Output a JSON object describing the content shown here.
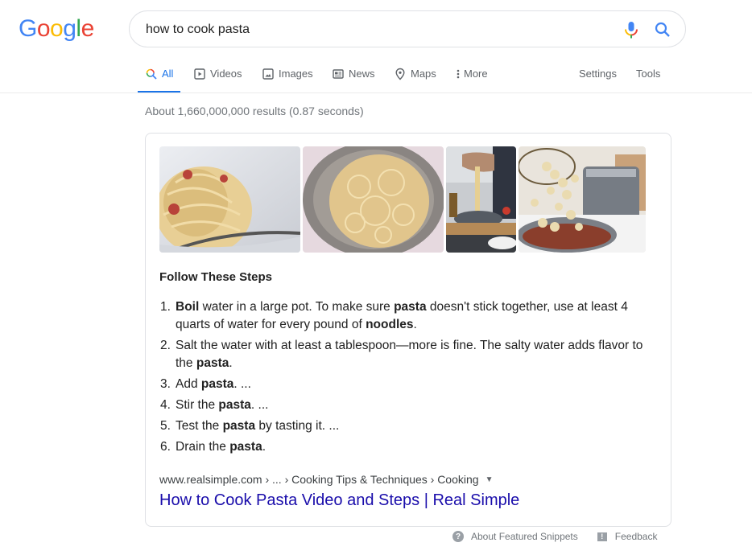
{
  "logo": {
    "letters": [
      {
        "ch": "G",
        "color": "#4285f4"
      },
      {
        "ch": "o",
        "color": "#ea4335"
      },
      {
        "ch": "o",
        "color": "#fbbc05"
      },
      {
        "ch": "g",
        "color": "#4285f4"
      },
      {
        "ch": "l",
        "color": "#34a853"
      },
      {
        "ch": "e",
        "color": "#ea4335"
      }
    ]
  },
  "search": {
    "query": "how to cook pasta",
    "mic_icon": "microphone-icon",
    "search_icon": "search-icon"
  },
  "tabs": {
    "all": "All",
    "videos": "Videos",
    "images": "Images",
    "news": "News",
    "maps": "Maps",
    "more": "More",
    "settings": "Settings",
    "tools": "Tools"
  },
  "results_stats": "About 1,660,000,000 results (0.87 seconds)",
  "snippet": {
    "images": [
      {
        "alt": "Spaghetti with fork on plate"
      },
      {
        "alt": "Spaghetti in colander"
      },
      {
        "alt": "Person lifting spaghetti from bowl"
      },
      {
        "alt": "Pasta pouring from strainer into pot"
      }
    ],
    "title": "Follow These Steps",
    "steps": [
      {
        "num": "1.",
        "parts": [
          {
            "b": "Boil"
          },
          {
            "t": " water in a large pot. To make sure "
          },
          {
            "b": "pasta"
          },
          {
            "t": " doesn't stick together, use at least 4 quarts of water for every pound of "
          },
          {
            "b": "noodles"
          },
          {
            "t": "."
          }
        ]
      },
      {
        "num": "2.",
        "parts": [
          {
            "t": "Salt the water with at least a tablespoon—more is fine. The salty water adds flavor to the "
          },
          {
            "b": "pasta"
          },
          {
            "t": "."
          }
        ]
      },
      {
        "num": "3.",
        "parts": [
          {
            "t": "Add "
          },
          {
            "b": "pasta"
          },
          {
            "t": ". ..."
          }
        ]
      },
      {
        "num": "4.",
        "parts": [
          {
            "t": "Stir the "
          },
          {
            "b": "pasta"
          },
          {
            "t": ". ..."
          }
        ]
      },
      {
        "num": "5.",
        "parts": [
          {
            "t": "Test the "
          },
          {
            "b": "pasta"
          },
          {
            "t": " by tasting it. ..."
          }
        ]
      },
      {
        "num": "6.",
        "parts": [
          {
            "t": "Drain the "
          },
          {
            "b": "pasta"
          },
          {
            "t": "."
          }
        ]
      }
    ],
    "cite": "www.realsimple.com › ... › Cooking Tips & Techniques › Cooking",
    "cite_caret": "▼",
    "link_title": "How to Cook Pasta Video and Steps | Real Simple"
  },
  "footer": {
    "about": "About Featured Snippets",
    "feedback": "Feedback"
  },
  "colors": {
    "accent": "#1a73e8",
    "link": "#1a0dab"
  }
}
